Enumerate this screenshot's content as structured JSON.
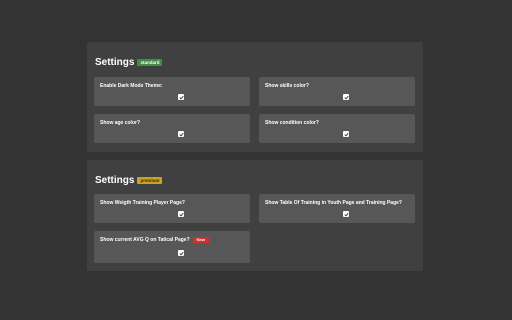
{
  "sections": [
    {
      "title": "Settings",
      "badge": "standard",
      "options": [
        {
          "label": "Enable Dark Mode Theme:",
          "checked": true
        },
        {
          "label": "Show skills color?",
          "checked": true
        },
        {
          "label": "Show age color?",
          "checked": true
        },
        {
          "label": "Show condition color?",
          "checked": true
        }
      ]
    },
    {
      "title": "Settings",
      "badge": "premium",
      "options": [
        {
          "label": "Show Weigth Training Player Page?",
          "checked": true
        },
        {
          "label": "Show Table Of Training in Youth Page and Training Page?",
          "checked": true
        },
        {
          "label": "Show current AVG Q on Tatical Page?",
          "checked": true,
          "tag": "New"
        }
      ]
    }
  ],
  "colors": {
    "background": "#333333",
    "panel": "#404040",
    "card": "#575757",
    "standard_badge": "#3e8e41",
    "premium_badge": "#c9a227",
    "new_badge": "#d32f2f"
  },
  "icons": {
    "checkbox": "checkmark-icon"
  }
}
